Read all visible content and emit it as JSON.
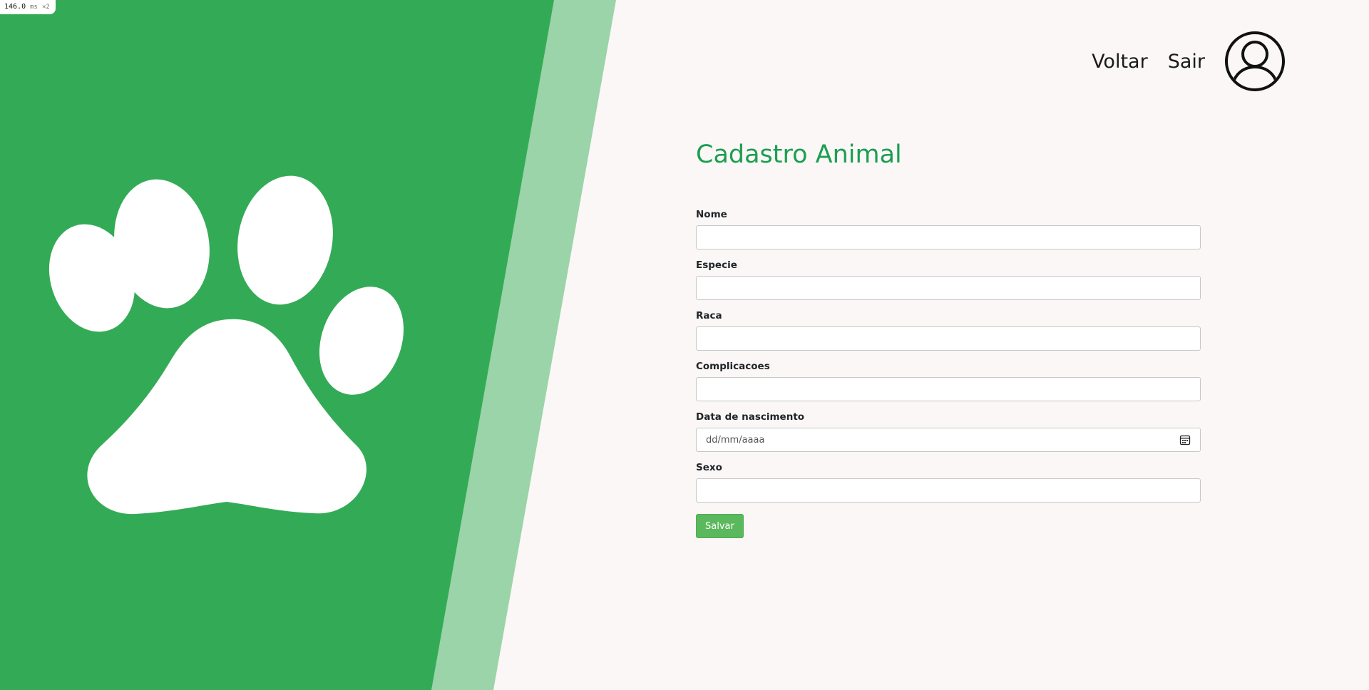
{
  "perf": {
    "value": "146.0",
    "unit": "ms",
    "mult": "×2"
  },
  "colors": {
    "panel_green": "#33ab56",
    "panel_stripe": "#9bd4a8",
    "background": "#faf7f6",
    "title_green": "#1c9e52",
    "button_green": "#5cb85c"
  },
  "nav": {
    "back_label": "Voltar",
    "logout_label": "Sair",
    "avatar_icon": "user-circle-icon"
  },
  "hero_icon": "paw-icon",
  "form": {
    "title": "Cadastro Animal",
    "fields": {
      "nome": {
        "label": "Nome",
        "value": ""
      },
      "especie": {
        "label": "Especie",
        "value": ""
      },
      "raca": {
        "label": "Raca",
        "value": ""
      },
      "complicacoes": {
        "label": "Complicacoes",
        "value": ""
      },
      "nascimento": {
        "label": "Data de nascimento",
        "placeholder": "dd/mm/aaaa",
        "icon": "calendar-icon"
      },
      "sexo": {
        "label": "Sexo",
        "value": ""
      }
    },
    "save_label": "Salvar"
  }
}
